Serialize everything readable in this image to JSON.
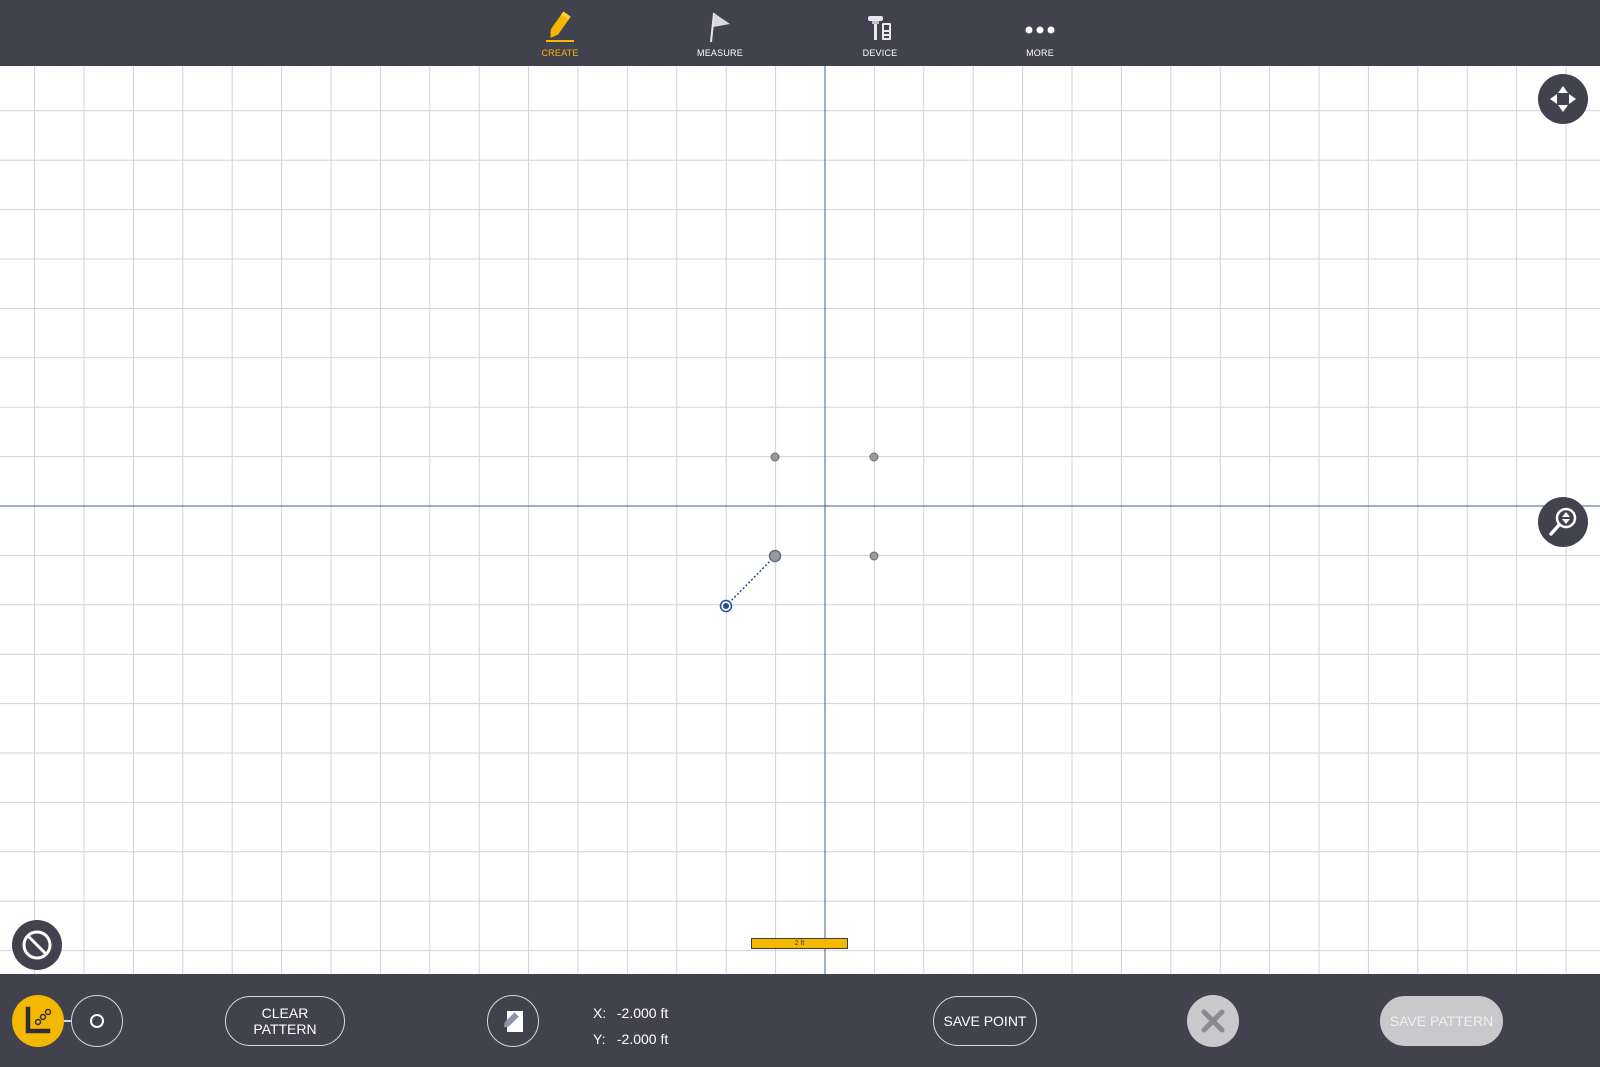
{
  "nav": [
    {
      "key": "create",
      "label": "CREATE",
      "icon": "pencil-icon",
      "active": true
    },
    {
      "key": "measure",
      "label": "MEASURE",
      "icon": "flag-icon",
      "active": false
    },
    {
      "key": "device",
      "label": "DEVICE",
      "icon": "device-icon",
      "active": false
    },
    {
      "key": "more",
      "label": "MORE",
      "icon": "more-dots-icon",
      "active": false
    }
  ],
  "scale": {
    "label": "2 ft"
  },
  "coords": {
    "x_label": "X:",
    "x_value": "-2.000 ft",
    "y_label": "Y:",
    "y_value": "-2.000 ft"
  },
  "buttons": {
    "clear_pattern": "CLEAR PATTERN",
    "save_point": "SAVE POINT",
    "save_pattern": "SAVE PATTERN"
  },
  "colors": {
    "bar": "#42424f",
    "accent": "#f5b800",
    "axis": "#3f5f8a",
    "grid": "#c9ccd6",
    "point_gray": "#8a8a8a",
    "point_blue": "#1f4e8c"
  }
}
